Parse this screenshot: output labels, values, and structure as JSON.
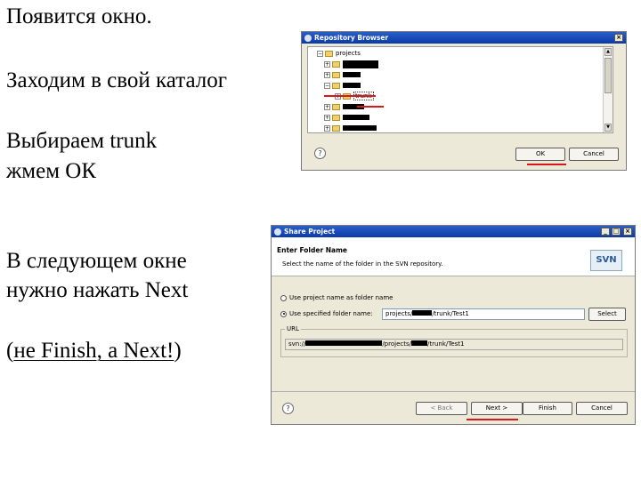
{
  "slide": {
    "line1": "Появится окно.",
    "line2": "Заходим в свой каталог",
    "line3a": "Выбираем trunk",
    "line3b": "жмем ОК",
    "line4a": "В следующем окне",
    "line4b": "нужно нажать Next",
    "line5_open": "(",
    "line5_a": "не Finish, а Next!",
    "line5_close": ")"
  },
  "repo_browser": {
    "title": "Repository Browser",
    "tree": {
      "root": "projects",
      "selected": "trunk"
    },
    "ok_label": "OK",
    "cancel_label": "Cancel",
    "help_label": "?"
  },
  "share_project": {
    "title": "Share Project",
    "heading": "Enter Folder Name",
    "description": "Select the name of the folder in the SVN repository.",
    "logo": "SVN",
    "option1": "Use project name as folder name",
    "option2": "Use specified folder name:",
    "folder_value_a": "projects/",
    "folder_value_b": "/trunk/Test1",
    "select_label": "Select",
    "url_group": "URL",
    "url_a": "svn://",
    "url_b": "/projects/",
    "url_c": "/trunk/Test1",
    "back_label": "< Back",
    "next_label": "Next >",
    "finish_label": "Finish",
    "cancel_label": "Cancel",
    "help_label": "?"
  },
  "colors": {
    "annotation_red": "#d8161b",
    "titlebar": "#0a3aa8"
  }
}
